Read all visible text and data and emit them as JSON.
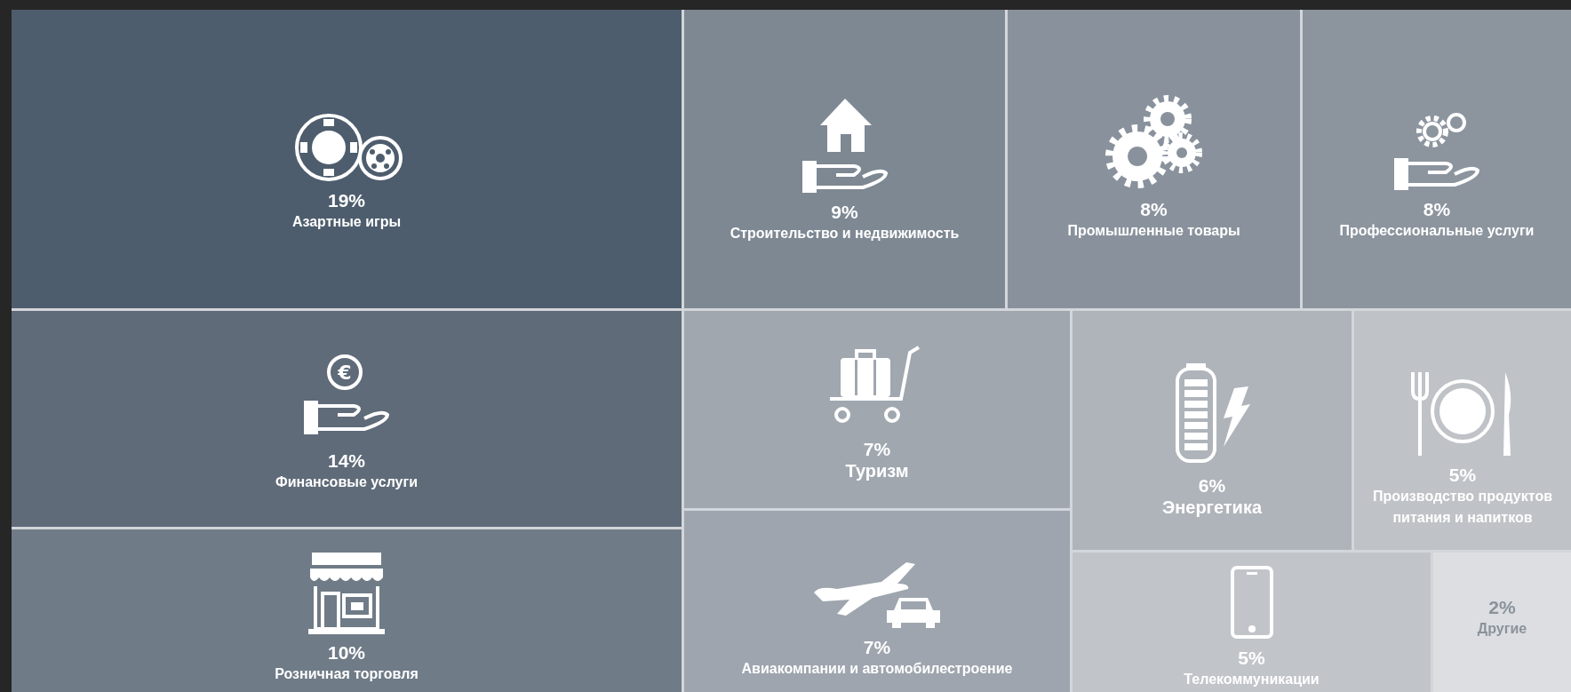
{
  "treemap": {
    "tiles": [
      {
        "kind": "gambling",
        "percent": "19%",
        "label": "Азартные игры",
        "featured": false,
        "color": "#4e5d6d"
      },
      {
        "kind": "construction",
        "percent": "9%",
        "label": "Строительство и недвижимость",
        "featured": false,
        "color": "#7e8893"
      },
      {
        "kind": "industrial",
        "percent": "8%",
        "label": "Промышленные товары",
        "featured": false,
        "color": "#89929c"
      },
      {
        "kind": "professional",
        "percent": "8%",
        "label": "Профессиональные услуги",
        "featured": false,
        "color": "#8c949e"
      },
      {
        "kind": "finance",
        "symbol": "€",
        "percent": "14%",
        "label": "Финансовые услуги",
        "featured": false,
        "color": "#5f6b79"
      },
      {
        "kind": "tourism",
        "percent": "7%",
        "label": "Туризм",
        "featured": true,
        "color": "#a0a7af"
      },
      {
        "kind": "energy",
        "percent": "6%",
        "label": "Энергетика",
        "featured": true,
        "color": "#afb4ba"
      },
      {
        "kind": "food",
        "percent": "5%",
        "label": "Производство продуктов питания и напитков",
        "featured": false,
        "color": "#bfc3c7"
      },
      {
        "kind": "retail",
        "percent": "10%",
        "label": "Розничная торговля",
        "featured": false,
        "color": "#6f7b87"
      },
      {
        "kind": "airlines",
        "percent": "7%",
        "label": "Авиакомпании и автомобилестроение",
        "featured": false,
        "color": "#9ea5ae"
      },
      {
        "kind": "telecom",
        "percent": "5%",
        "label": "Телекоммуникации",
        "featured": false,
        "color": "#c1c5c9"
      },
      {
        "kind": "other",
        "percent": "2%",
        "label": "Другие",
        "featured": false,
        "color": "#dcdee1"
      }
    ]
  }
}
